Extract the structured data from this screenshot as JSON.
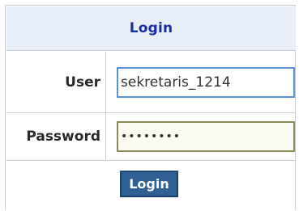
{
  "login_form": {
    "title": "Login",
    "user_label": "User",
    "user_value": "sekretaris_1214",
    "password_label": "Password",
    "password_value": "••••••••",
    "submit_label": "Login"
  },
  "colors": {
    "header_bg": "#e8eef8",
    "header_text": "#1c2e9e",
    "button_bg": "#2f5f93",
    "border": "#c8cdd6"
  }
}
